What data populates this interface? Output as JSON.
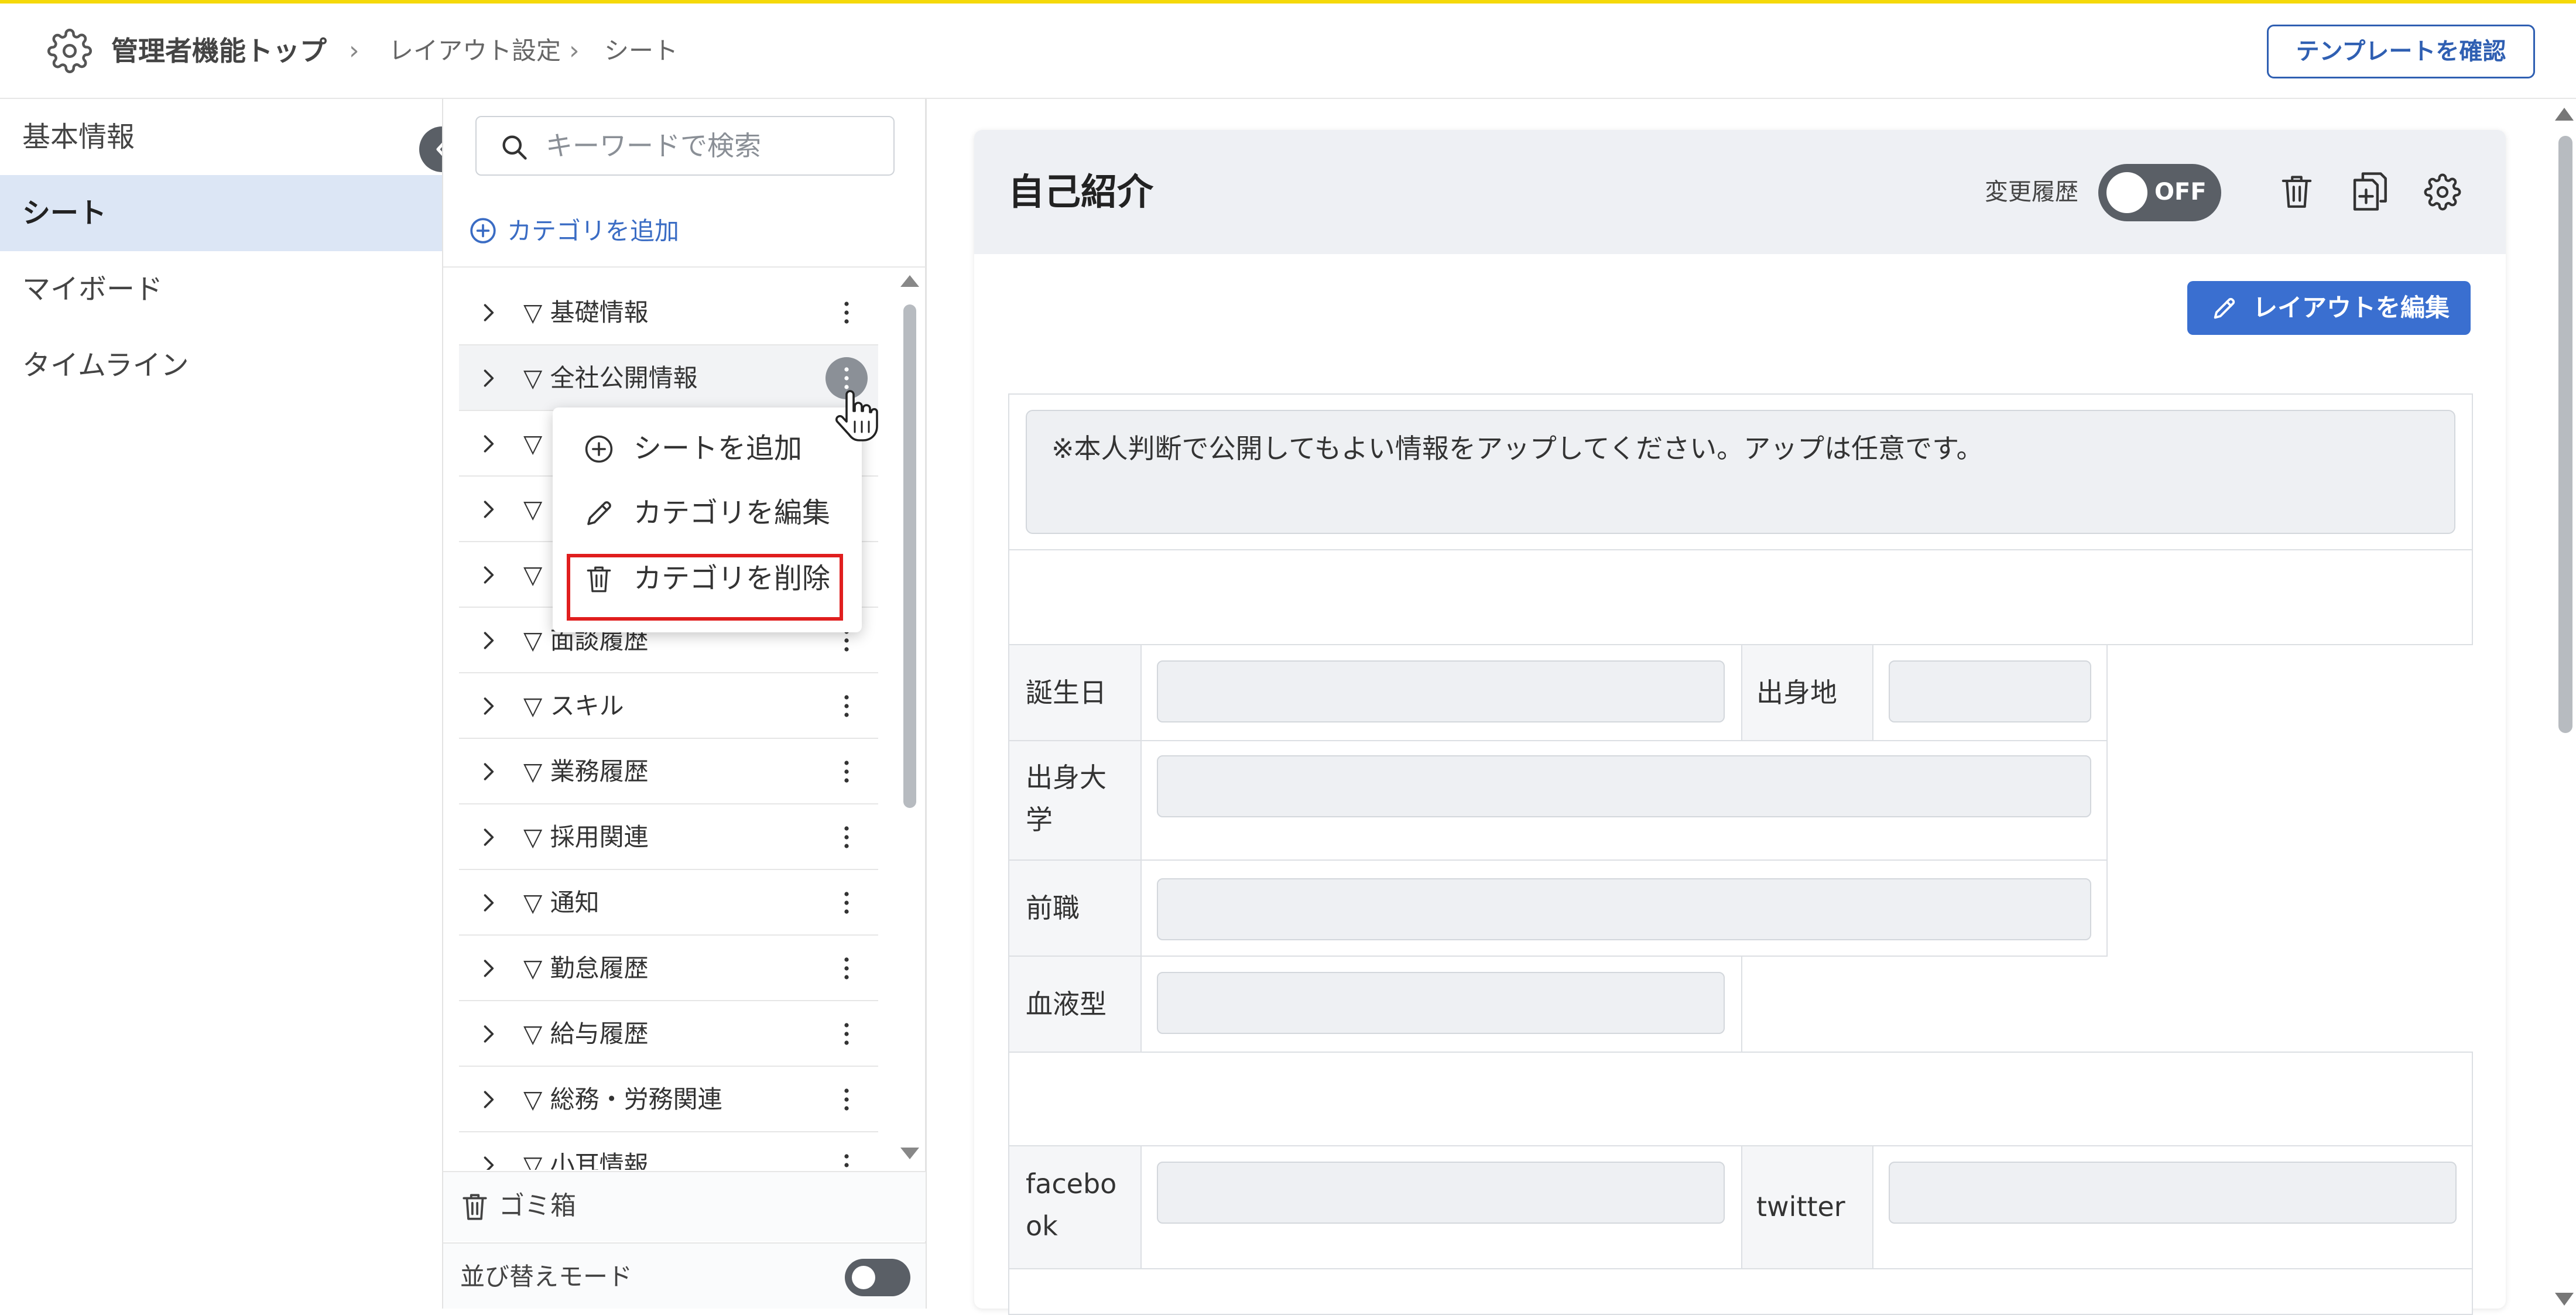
{
  "header": {
    "breadcrumb": [
      "管理者機能トップ",
      "レイアウト設定",
      "シート"
    ],
    "template_button": "テンプレートを確認"
  },
  "left_nav": {
    "items": [
      {
        "label": "基本情報",
        "active": false
      },
      {
        "label": "シート",
        "active": true
      },
      {
        "label": "マイボード",
        "active": false
      },
      {
        "label": "タイムライン",
        "active": false
      }
    ]
  },
  "category_panel": {
    "search_placeholder": "キーワードで検索",
    "add_category": "カテゴリを追加",
    "categories": [
      "▽ 基礎情報",
      "▽ 全社公開情報",
      "▽",
      "▽",
      "▽",
      "▽ 面談履歴",
      "▽ スキル",
      "▽ 業務履歴",
      "▽ 採用関連",
      "▽ 通知",
      "▽ 勤怠履歴",
      "▽ 給与履歴",
      "▽ 総務・労務関連",
      "▽ 小耳情報"
    ],
    "highlighted_index": 1,
    "trash": "ゴミ箱",
    "sort_mode": "並び替えモード",
    "sort_mode_on": false
  },
  "context_menu": {
    "items": [
      "シートを追加",
      "カテゴリを編集",
      "カテゴリを削除"
    ],
    "highlighted": "カテゴリを削除"
  },
  "sheet": {
    "title": "自己紹介",
    "history_label": "変更履歴",
    "history_toggle": "OFF",
    "edit_layout_button": "レイアウトを編集",
    "notice": "※本人判断で公開してもよい情報をアップしてください。アップは任意です。",
    "fields": {
      "birthday": "誕生日",
      "hometown": "出身地",
      "university": "出身大学",
      "previous_job": "前職",
      "blood_type": "血液型",
      "facebook": "facebook",
      "twitter": "twitter"
    }
  },
  "colors": {
    "accent_bar": "#f5d90a",
    "primary": "#3a6fd0",
    "nav_active_bg": "#dce6f5",
    "highlight_red": "#e01e1e"
  }
}
